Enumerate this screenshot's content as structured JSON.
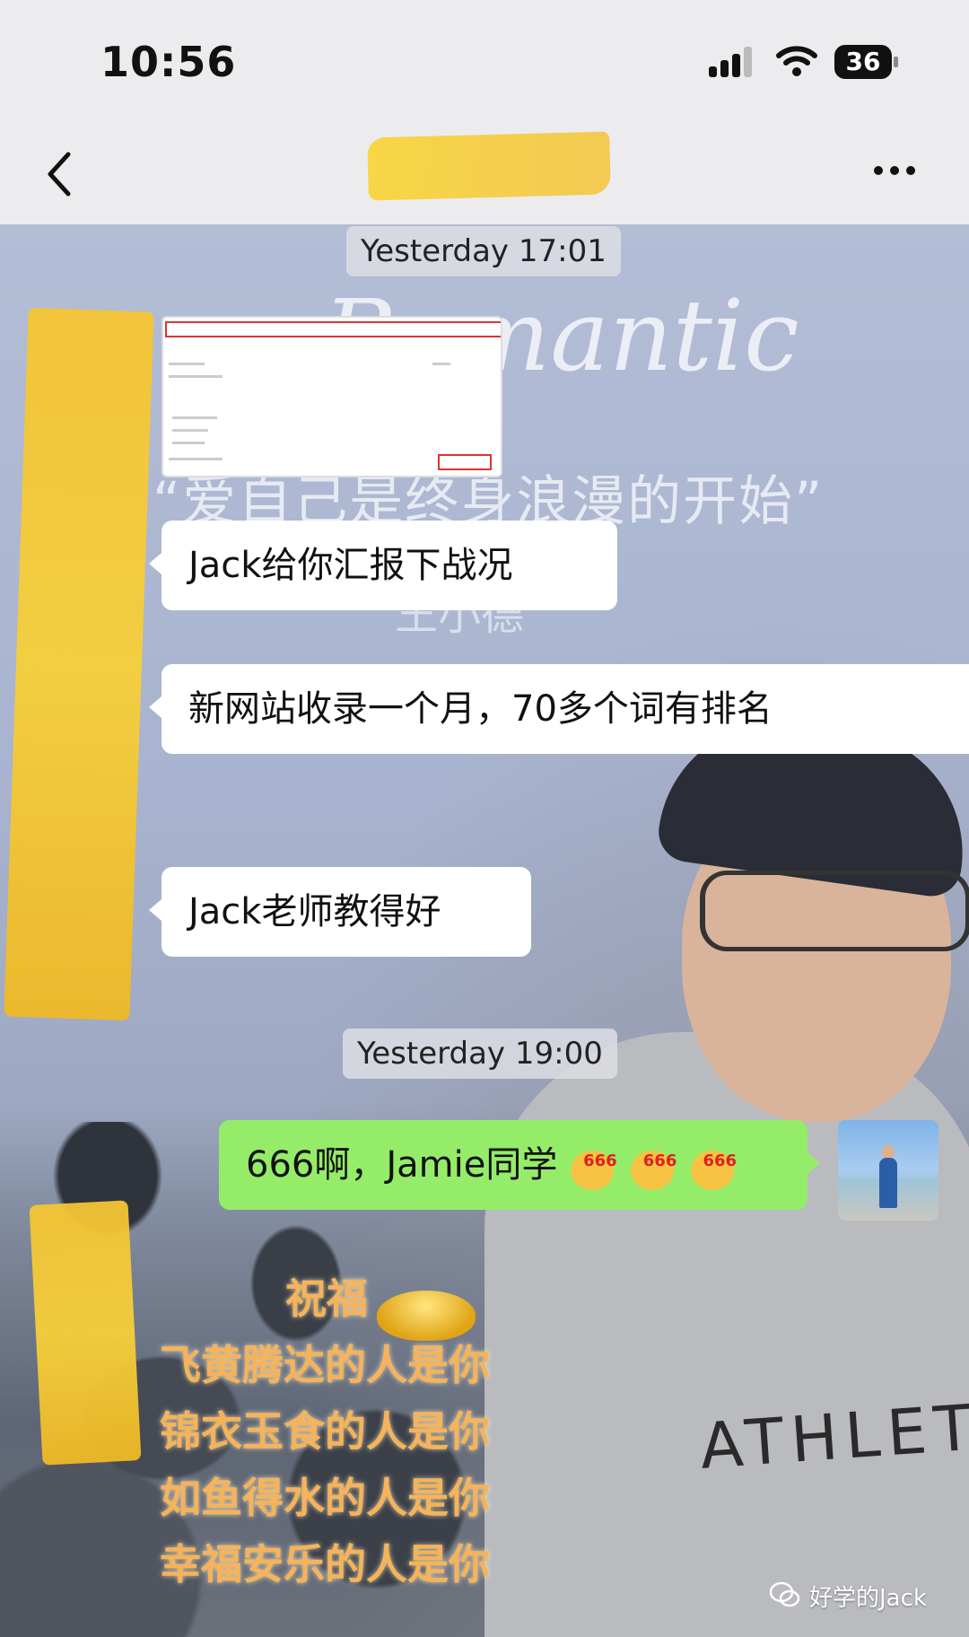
{
  "status_bar": {
    "time": "10:56",
    "battery": "36",
    "icons": [
      "signal-icon",
      "wifi-icon",
      "battery-icon"
    ]
  },
  "nav": {
    "back_icon": "chevron-left-icon",
    "title": "",
    "more_icon": "ellipsis-icon"
  },
  "wallpaper": {
    "script_text": "Romantic",
    "quote": "“爱自己是终身浪漫的开始”",
    "signature": "王小德",
    "shirt_text": "ATHLET",
    "blessing_lines": [
      "祝福",
      "飞黄腾达的人是你",
      "锦衣玉食的人是你",
      "如鱼得水的人是你",
      "幸福安乐的人是你"
    ]
  },
  "messages": [
    {
      "type": "timestamp",
      "text": "Yesterday 17:01"
    },
    {
      "type": "image",
      "from": "other",
      "description_icon": "screenshot-image"
    },
    {
      "type": "text",
      "from": "other",
      "text": "Jack给你汇报下战况"
    },
    {
      "type": "text",
      "from": "other",
      "text": "新网站收录一个月，70多个词有排名"
    },
    {
      "type": "text",
      "from": "other",
      "text": "Jack老师教得好"
    },
    {
      "type": "timestamp",
      "text": "Yesterday 19:00"
    },
    {
      "type": "text",
      "from": "me",
      "text": "666啊，Jamie同学",
      "emoji_label": "666",
      "emoji_count": 3
    }
  ],
  "watermark": "好学的Jack",
  "colors": {
    "my_bubble": "#95ec69",
    "their_bubble": "#ffffff",
    "status_bg": "#ececef",
    "redaction": "#f6c93a"
  }
}
